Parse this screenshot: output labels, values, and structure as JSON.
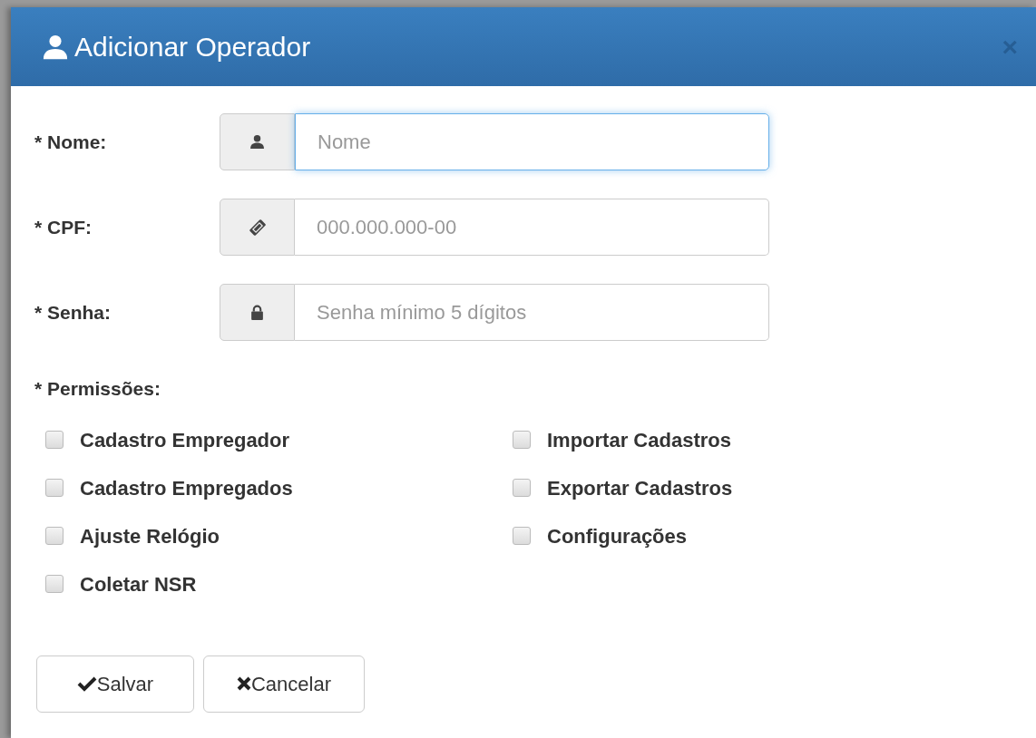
{
  "dialog": {
    "title": "Adicionar Operador",
    "close": "×"
  },
  "fields": [
    {
      "label": "* Nome:",
      "kind": "user",
      "placeholder": "Nome",
      "focused": true
    },
    {
      "label": "* CPF:",
      "kind": "ticket",
      "placeholder": "000.000.000-00",
      "focused": false
    },
    {
      "label": "* Senha:",
      "kind": "lock",
      "placeholder": "Senha mínimo 5 dígitos",
      "focused": false
    }
  ],
  "permissions": {
    "label": "* Permissões:",
    "items": [
      {
        "label": "Cadastro Empregador",
        "checked": false
      },
      {
        "label": "Importar Cadastros",
        "checked": false
      },
      {
        "label": "Cadastro Empregados",
        "checked": false
      },
      {
        "label": "Exportar Cadastros",
        "checked": false
      },
      {
        "label": "Ajuste Relógio",
        "checked": false
      },
      {
        "label": "Configurações",
        "checked": false
      },
      {
        "label": "Coletar NSR",
        "checked": false
      }
    ]
  },
  "buttons": [
    {
      "kind": "save",
      "label": "Salvar"
    },
    {
      "kind": "cancel",
      "label": "Cancelar"
    }
  ]
}
